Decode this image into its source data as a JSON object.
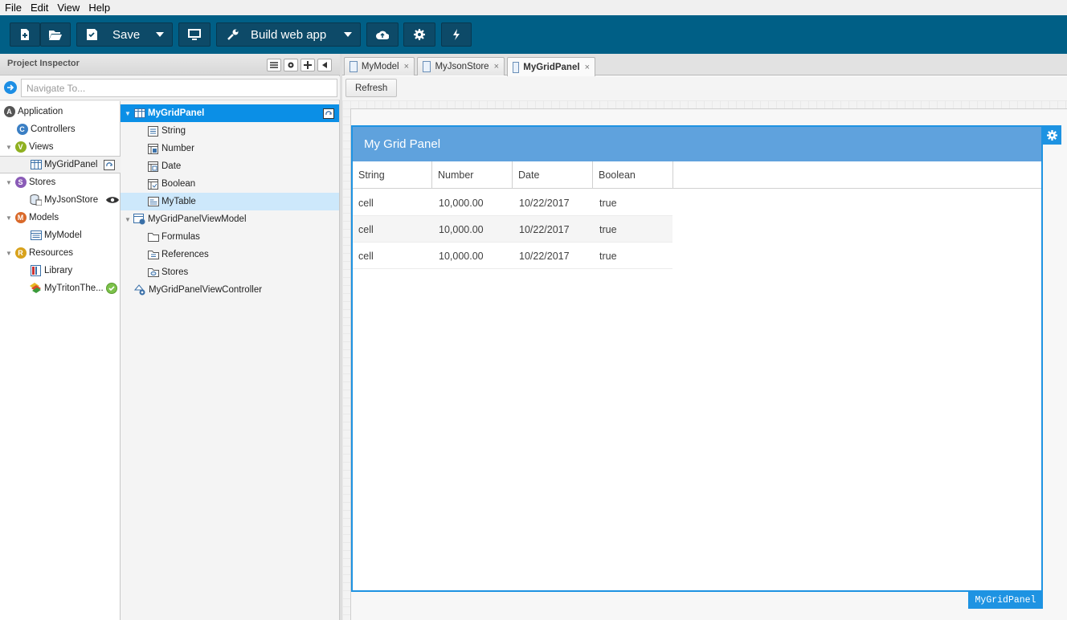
{
  "menu": [
    "File",
    "Edit",
    "View",
    "Help"
  ],
  "toolbar": {
    "save_label": "Save",
    "build_label": "Build web app"
  },
  "project_inspector": {
    "title": "Project Inspector",
    "navigate_placeholder": "Navigate To..."
  },
  "tree_left": [
    {
      "label": "Application"
    },
    {
      "label": "Controllers"
    },
    {
      "label": "Views"
    },
    {
      "label": "MyGridPanel"
    },
    {
      "label": "Stores"
    },
    {
      "label": "MyJsonStore"
    },
    {
      "label": "Models"
    },
    {
      "label": "MyModel"
    },
    {
      "label": "Resources"
    },
    {
      "label": "Library"
    },
    {
      "label": "MyTritonThe..."
    }
  ],
  "tree_right": [
    {
      "label": "MyGridPanel"
    },
    {
      "label": "String"
    },
    {
      "label": "Number"
    },
    {
      "label": "Date"
    },
    {
      "label": "Boolean"
    },
    {
      "label": "MyTable"
    },
    {
      "label": "MyGridPanelViewModel"
    },
    {
      "label": "Formulas"
    },
    {
      "label": "References"
    },
    {
      "label": "Stores"
    },
    {
      "label": "MyGridPanelViewController"
    }
  ],
  "tabs": [
    {
      "label": "MyModel"
    },
    {
      "label": "MyJsonStore"
    },
    {
      "label": "MyGridPanel"
    }
  ],
  "refresh_label": "Refresh",
  "grid": {
    "title": "My Grid Panel",
    "columns": [
      "String",
      "Number",
      "Date",
      "Boolean"
    ],
    "rows": [
      [
        "cell",
        "10,000.00",
        "10/22/2017",
        "true"
      ],
      [
        "cell",
        "10,000.00",
        "10/22/2017",
        "true"
      ],
      [
        "cell",
        "10,000.00",
        "10/22/2017",
        "true"
      ]
    ],
    "component_name": "MyGridPanel"
  },
  "colors": {
    "toolbar_bg": "#005f86",
    "selection": "#0b8fe6",
    "grid_header": "#5fa2dd",
    "grid_border": "#1e93e2"
  }
}
